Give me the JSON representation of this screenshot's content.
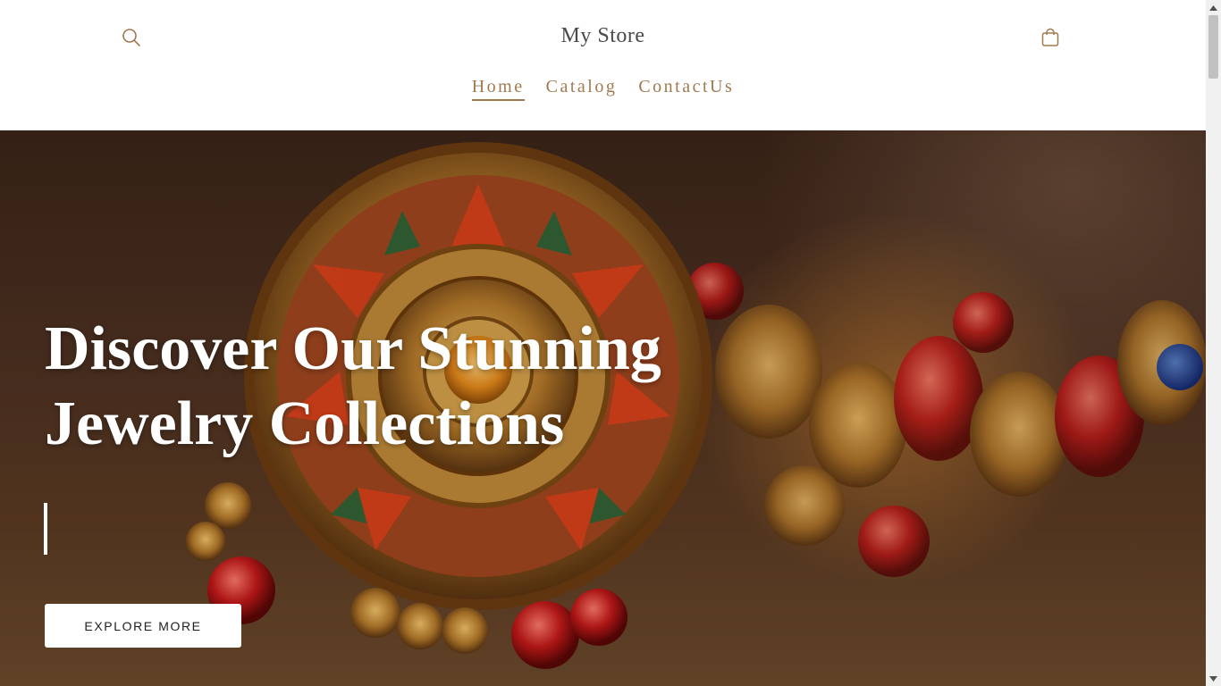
{
  "header": {
    "store_title": "My Store",
    "search_icon": "search-icon",
    "cart_icon": "bag-icon"
  },
  "nav": {
    "items": [
      {
        "label": "Home",
        "active": true
      },
      {
        "label": "Catalog",
        "active": false
      },
      {
        "label": "ContactUs",
        "active": false
      }
    ]
  },
  "hero": {
    "heading_line1": "Discover Our Stunning",
    "heading_line2": "Jewelry Collections",
    "button_label": "EXPLORE MORE"
  },
  "colors": {
    "accent": "#a07a4e",
    "title": "#4a4a4a",
    "hero_text": "#ffffff"
  }
}
